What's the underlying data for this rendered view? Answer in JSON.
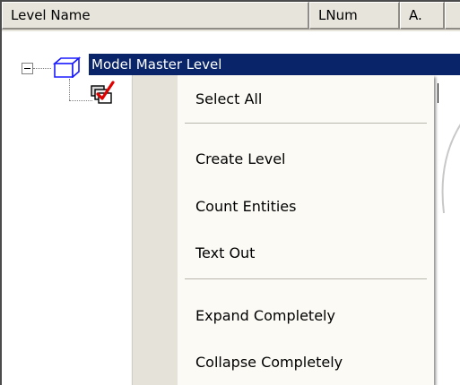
{
  "table": {
    "columns": [
      {
        "key": "name",
        "label": "Level Name"
      },
      {
        "key": "lnum",
        "label": "LNum"
      },
      {
        "key": "a",
        "label": "A."
      },
      {
        "key": "rest",
        "label": ""
      }
    ]
  },
  "tree": {
    "root_label": "Model Master Level",
    "root_selected": true
  },
  "context_menu": {
    "items": [
      {
        "id": "select-all",
        "label": "Select All"
      },
      {
        "id": "create-level",
        "label": "Create Level"
      },
      {
        "id": "count-entities",
        "label": "Count Entities"
      },
      {
        "id": "text-out",
        "label": "Text Out"
      },
      {
        "id": "expand-completely",
        "label": "Expand Completely"
      },
      {
        "id": "collapse-completely",
        "label": "Collapse Completely"
      }
    ]
  },
  "colors": {
    "selection": "#0a246a",
    "header_bg": "#e6e4db",
    "menu_bg": "#fbfaf5",
    "menu_gutter": "#e4e2d9"
  },
  "icons": {
    "root": "cube-icon",
    "child": "layers-checked-icon",
    "expander": "collapse-minus-icon"
  }
}
